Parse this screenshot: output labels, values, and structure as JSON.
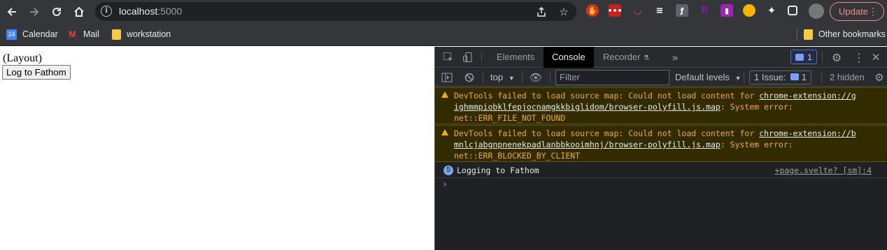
{
  "browser": {
    "url_host": "localhost",
    "url_port": ":5000",
    "update_label": "Update"
  },
  "bookmarks": {
    "items": [
      {
        "label": "Calendar",
        "icon": "calendar-icon",
        "icon_text": "24"
      },
      {
        "label": "Mail",
        "icon": "gmail-icon",
        "icon_text": "M"
      },
      {
        "label": "workstation",
        "icon": "folder-icon"
      }
    ],
    "other": "Other bookmarks"
  },
  "page": {
    "layout_text": "(Layout)",
    "button_label": "Log to Fathom"
  },
  "devtools": {
    "tabs": [
      "Elements",
      "Console",
      "Recorder"
    ],
    "active_tab": "Console",
    "issues_badge_count": "1",
    "context": "top",
    "filter_placeholder": "Filter",
    "levels": "Default levels",
    "issues_label": "1 Issue:",
    "issues_count": "1",
    "hidden": "2 hidden",
    "messages": [
      {
        "type": "warning",
        "lines": [
          {
            "pre": "DevTools failed to load source map: Could not load content for ",
            "link": "chrome-extension://g",
            "post": ""
          },
          {
            "pre": "",
            "link": "ighmmpiobklfepjocnamgkkbiglidom/browser-polyfill.js.map",
            "post": ": System error:"
          },
          {
            "pre": "net::ERR_FILE_NOT_FOUND",
            "link": "",
            "post": ""
          }
        ]
      },
      {
        "type": "warning",
        "lines": [
          {
            "pre": "DevTools failed to load source map: Could not load content for ",
            "link": "chrome-extension://b",
            "post": ""
          },
          {
            "pre": "",
            "link": "mnlcjabgnpnenekpadlanbbkooimhnj/browser-polyfill.js.map",
            "post": ": System error:"
          },
          {
            "pre": "net::ERR_BLOCKED_BY_CLIENT",
            "link": "",
            "post": ""
          }
        ]
      },
      {
        "type": "log",
        "count": "5",
        "text": "Logging to Fathom",
        "source": "+page.svelte? [sm]:4"
      }
    ],
    "prompt": "›"
  },
  "colors": {
    "warning_text": "#f2ab26",
    "warning_bg": "#332b00",
    "accent_blue": "#7cacf8"
  }
}
